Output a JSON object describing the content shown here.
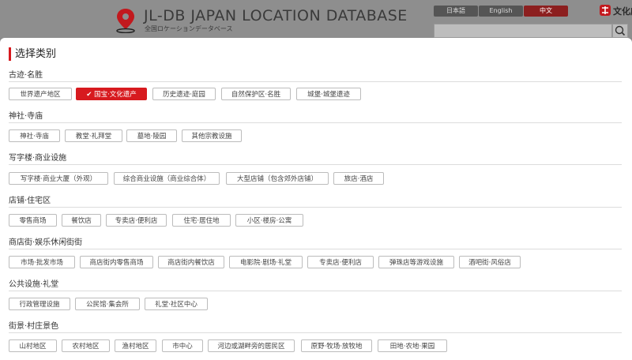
{
  "header": {
    "logo_title": "JL-DB JAPAN LOCATION DATABASE",
    "logo_subtitle": "全国ロケーションデータベース",
    "languages": [
      "日本語",
      "English",
      "中文"
    ],
    "active_language": "中文",
    "brand_text": "文化庁"
  },
  "colors": {
    "accent": "#d71a1f",
    "header_bg": "#8e8e8e"
  },
  "modal": {
    "title": "选择类别",
    "sections": [
      {
        "title": "古迹·名胜",
        "tags": [
          "世界遗产地区",
          "国宝·文化遗产",
          "历史遗迹·庭园",
          "自然保护区·名胜",
          "城堡·城堡遗迹"
        ],
        "selected": "国宝·文化遗产"
      },
      {
        "title": "神社·寺庙",
        "tags": [
          "神社·寺庙",
          "教堂·礼拜堂",
          "墓地·陵园",
          "其他宗教设施"
        ]
      },
      {
        "title": "写字楼·商业设施",
        "tags": [
          "写字楼·商业大厦（外观）",
          "综合商业设施（商业综合体）",
          "大型店铺（包含郊外店铺）",
          "旅店·酒店"
        ]
      },
      {
        "title": "店铺·住宅区",
        "tags": [
          "零售商场",
          "餐饮店",
          "专卖店·便利店",
          "住宅·居住地",
          "小区·楼房·公寓"
        ]
      },
      {
        "title": "商店街·娱乐休闲街街",
        "tags": [
          "市场·批发市场",
          "商店街内零售商场",
          "商店街内餐饮店",
          "电影院·剧场·礼堂",
          "专卖店·便利店",
          "弹珠店等游戏设施",
          "酒吧街·风俗店"
        ]
      },
      {
        "title": "公共设施·礼堂",
        "tags": [
          "行政管理设施",
          "公民馆·集会所",
          "礼堂·社区中心"
        ]
      },
      {
        "title": "街景·村庄景色",
        "tags": [
          "山村地区",
          "农村地区",
          "渔村地区",
          "市中心",
          "河边或湖畔旁的居民区",
          "原野·牧场·放牧地",
          "田地·农地·果园"
        ]
      }
    ]
  }
}
